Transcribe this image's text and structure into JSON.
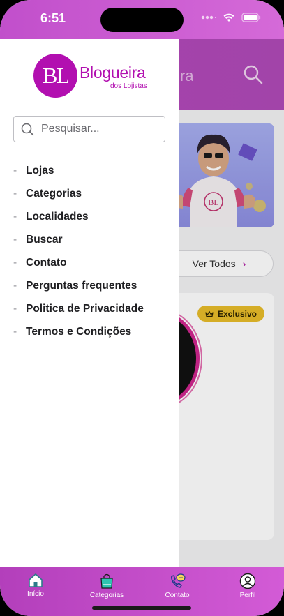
{
  "status": {
    "time": "6:51"
  },
  "brand": {
    "monogram": "BL",
    "name": "Blogueira",
    "tagline": "dos Lojistas"
  },
  "search": {
    "placeholder": "Pesquisar..."
  },
  "menu": {
    "items": [
      {
        "label": "Lojas"
      },
      {
        "label": "Categorias"
      },
      {
        "label": "Localidades"
      },
      {
        "label": "Buscar"
      },
      {
        "label": "Contato"
      },
      {
        "label": "Perguntas frequentes"
      },
      {
        "label": "Politica de Privacidade"
      },
      {
        "label": "Termos e Condições"
      }
    ]
  },
  "background": {
    "ver_todos_label": "Ver Todos",
    "exclusive_label": "Exclusivo",
    "banner_shirt_text": "BL"
  },
  "tabbar": {
    "tabs": [
      {
        "label": "Início",
        "icon": "home-icon"
      },
      {
        "label": "Categorias",
        "icon": "shopping-bag-icon"
      },
      {
        "label": "Contato",
        "icon": "phone-chat-icon"
      },
      {
        "label": "Perfil",
        "icon": "user-icon"
      }
    ]
  },
  "colors": {
    "brand_magenta": "#b20fb0",
    "header_purple": "#b447bd",
    "badge_gold": "#e8bc2a"
  }
}
